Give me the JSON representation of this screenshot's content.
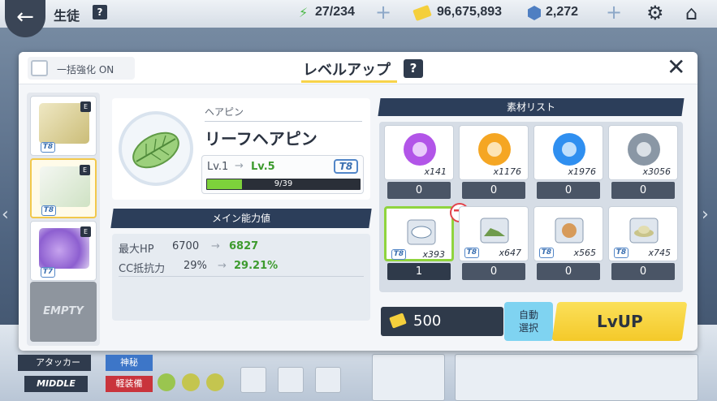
{
  "topbar": {
    "title": "生徒",
    "help": "?",
    "ap": "27/234",
    "credits": "96,675,893",
    "gems": "2,272"
  },
  "modal": {
    "bulk_label": "一括強化 ON",
    "title": "レベルアップ",
    "help": "?",
    "close": "✕"
  },
  "slots": {
    "tiers": [
      "T8",
      "T8",
      "T7"
    ],
    "empty_label": "EMPTY"
  },
  "item": {
    "type": "ヘアピン",
    "name": "リーフヘアピン",
    "lv_from": "Lv.1",
    "lv_arrow": "→",
    "lv_to": "Lv.5",
    "tier": "T8",
    "exp_text": "9/39",
    "exp_progress": 0.23
  },
  "stats": {
    "header": "メイン能力値",
    "rows": [
      {
        "label": "最大HP",
        "old": "6700",
        "arrow": "→",
        "new": "6827"
      },
      {
        "label": "CC抵抗力",
        "old": "29%",
        "arrow": "→",
        "new": "29.21%"
      }
    ]
  },
  "materials": {
    "header": "素材リスト",
    "items": [
      {
        "count": "x141",
        "qty": "0",
        "color": "#b255e8"
      },
      {
        "count": "x1176",
        "qty": "0",
        "color": "#f5a623"
      },
      {
        "count": "x1976",
        "qty": "0",
        "color": "#2f8ff0"
      },
      {
        "count": "x3056",
        "qty": "0",
        "color": "#8a97a5"
      },
      {
        "count": "x393",
        "qty": "1",
        "tier": "T8",
        "color": "#e9eef3"
      },
      {
        "count": "x647",
        "qty": "0",
        "tier": "T8",
        "color": "#6f9b4d"
      },
      {
        "count": "x565",
        "qty": "0",
        "tier": "T8",
        "color": "#d79b5a"
      },
      {
        "count": "x745",
        "qty": "0",
        "tier": "T8",
        "color": "#c9c48a"
      }
    ]
  },
  "actions": {
    "cost": "500",
    "auto_label_1": "自動",
    "auto_label_2": "選択",
    "lvup_label": "LvUP"
  },
  "bottom": {
    "role": "アタッカー",
    "position": "MIDDLE",
    "element": "神秘",
    "armor": "軽装備"
  }
}
